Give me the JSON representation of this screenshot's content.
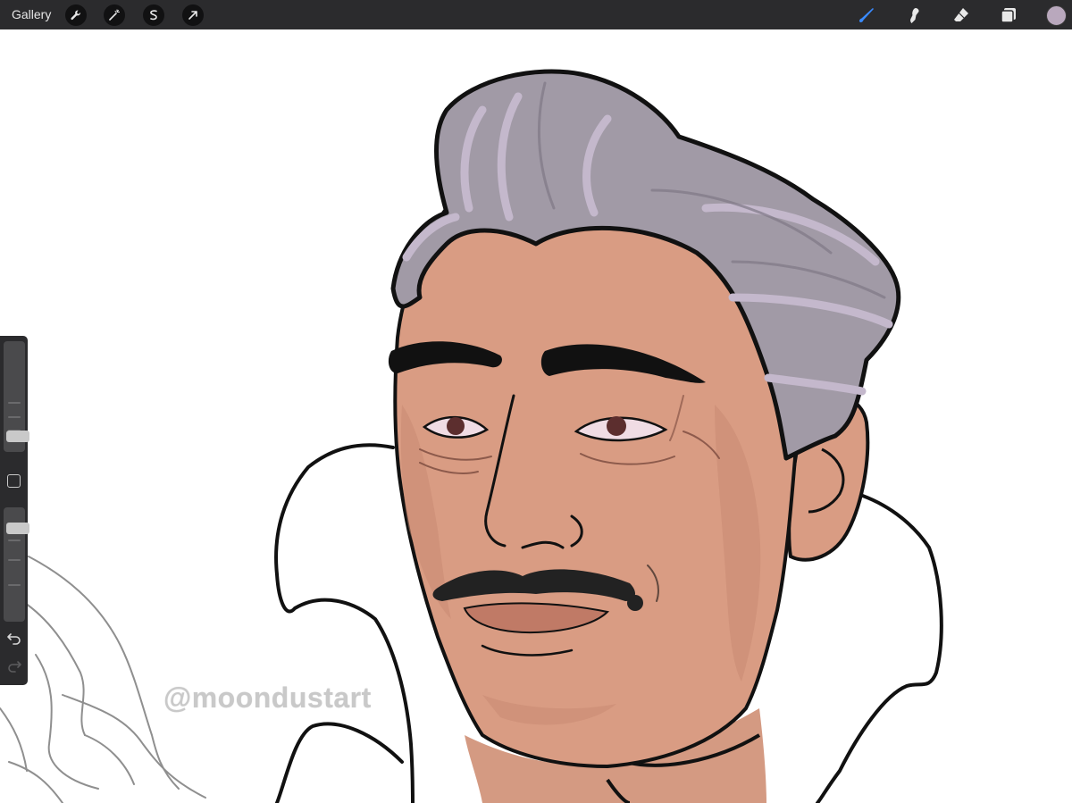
{
  "toolbar": {
    "gallery_label": "Gallery",
    "left_tools": [
      {
        "icon": "wrench-icon"
      },
      {
        "icon": "magic-wand-icon"
      },
      {
        "icon": "selection-icon"
      },
      {
        "icon": "transform-arrow-icon"
      }
    ],
    "right_tools": [
      {
        "icon": "brush-icon",
        "active": true,
        "color": "#3a8bff"
      },
      {
        "icon": "smudge-icon",
        "active": false
      },
      {
        "icon": "eraser-icon",
        "active": false
      },
      {
        "icon": "layers-icon",
        "active": false
      }
    ],
    "current_color": "#b9a8bd"
  },
  "sidebar": {
    "brush_size_level": 0.1,
    "opacity_level": 0.15,
    "undo_icon": "undo-icon",
    "redo_icon": "redo-icon"
  },
  "canvas": {
    "watermark": "@moondustart",
    "colors": {
      "hair": "#a19aa6",
      "hair_highlight": "#c4b8cc",
      "skin": "#d99c83",
      "skin_shadow": "#c98a73",
      "line": "#111111",
      "sketch": "#9a9a9a"
    }
  }
}
